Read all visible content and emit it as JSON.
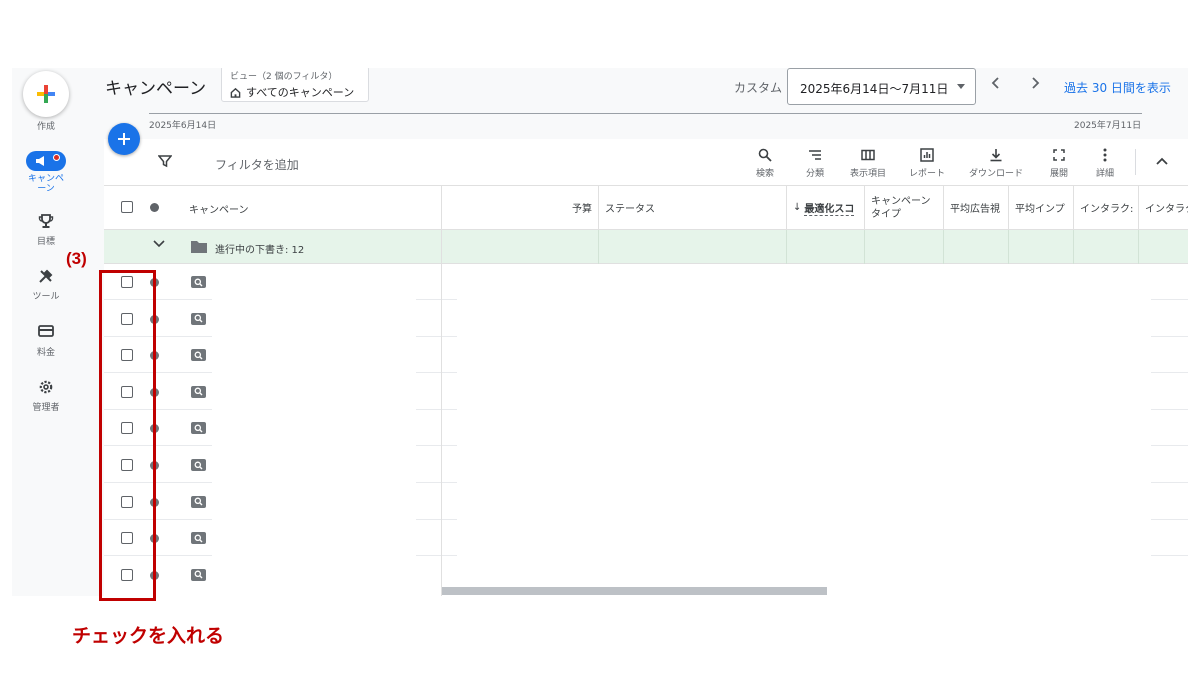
{
  "sidebar": {
    "create_label": "作成",
    "items": [
      {
        "label": "キャンペーン",
        "icon": "megaphone-icon"
      },
      {
        "label": "目標",
        "icon": "trophy-icon"
      },
      {
        "label": "ツール",
        "icon": "tools-icon"
      },
      {
        "label": "料金",
        "icon": "credit-card-icon"
      },
      {
        "label": "管理者",
        "icon": "gear-icon"
      }
    ]
  },
  "header": {
    "title": "キャンペーン",
    "view_subtitle": "ビュー（2 個のフィルタ）",
    "view_name": "すべてのキャンペーン",
    "date_mode": "カスタム",
    "date_range": "2025年6月14日〜7月11日",
    "last_30_link": "過去 30 日間を表示"
  },
  "timeline": {
    "start": "2025年6月14日",
    "end": "2025年7月11日"
  },
  "toolbar": {
    "filter_placeholder": "フィルタを追加",
    "tools": [
      "検索",
      "分類",
      "表示項目",
      "レポート",
      "ダウンロード",
      "展開",
      "詳細"
    ]
  },
  "table": {
    "columns": [
      "キャンペーン",
      "予算",
      "ステータス",
      "最適化スコ",
      "キャンペーンタイプ",
      "平均広告視",
      "平均インプ",
      "インタラク:",
      "インタラク"
    ],
    "column_type_line1": "キャンペーン",
    "column_type_line2": "タイプ",
    "group_label": "進行中の下書き: 12",
    "row_count": 9
  },
  "annotation": {
    "step": "(3)",
    "caption": "チェックを入れる",
    "color": "#c00000"
  },
  "colors": {
    "accent": "#1a73e8",
    "group_bg": "#e6f4ea"
  }
}
